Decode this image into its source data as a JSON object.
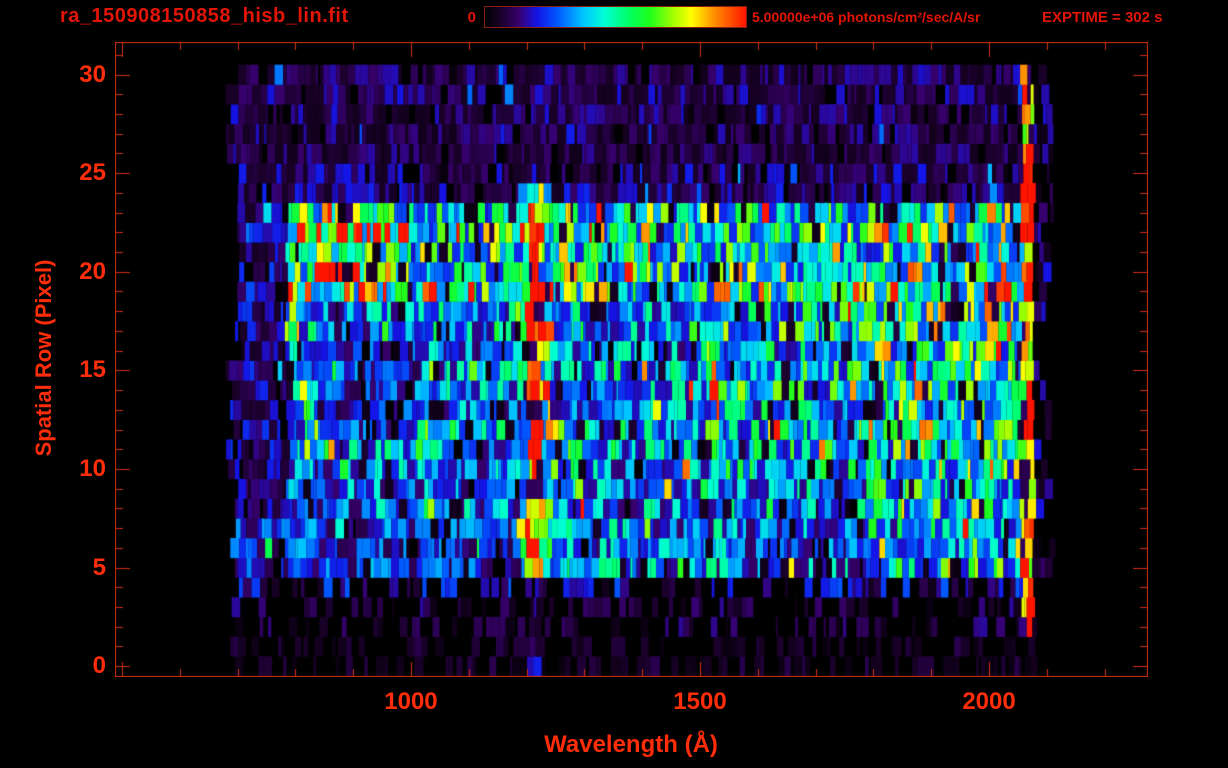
{
  "header": {
    "title": "ra_150908150858_hisb_lin.fit",
    "colorbar": {
      "min_label": "0",
      "max_label": "5.00000e+06 photons/cm²/sec/A/sr"
    },
    "exptime_label": "EXPTIME = 302 s"
  },
  "colors": {
    "accent": "#d2300e",
    "label_red": "#ff2d0a",
    "header_red": "#e21507",
    "background": "#000000"
  },
  "chart_data": {
    "type": "heatmap",
    "title": "ra_150908150858_hisb_lin.fit",
    "xlabel": "Wavelength (Å)",
    "ylabel": "Spatial Row (Pixel)",
    "x_axis": {
      "min": 488,
      "max": 2275,
      "labeled_ticks": [
        1000,
        1500,
        2000
      ],
      "minor_step": 100,
      "major_step": 500,
      "minor_from": 500,
      "minor_to": 2200
    },
    "y_axis": {
      "min": -0.55,
      "max": 31.65,
      "labeled_ticks": [
        0,
        5,
        10,
        15,
        20,
        25,
        30
      ],
      "minor_step": 1,
      "major_step": 5
    },
    "colorbar": {
      "min": 0,
      "max": 5000000,
      "units": "photons/cm²/sec/A/sr"
    },
    "exposure_seconds": 302,
    "grid": false,
    "colormap": {
      "stops": [
        [
          0.0,
          0,
          0,
          0
        ],
        [
          0.06,
          25,
          0,
          40
        ],
        [
          0.13,
          55,
          0,
          110
        ],
        [
          0.2,
          20,
          20,
          230
        ],
        [
          0.28,
          0,
          90,
          255
        ],
        [
          0.38,
          0,
          200,
          255
        ],
        [
          0.46,
          0,
          255,
          210
        ],
        [
          0.56,
          0,
          255,
          90
        ],
        [
          0.63,
          30,
          255,
          30
        ],
        [
          0.72,
          160,
          255,
          0
        ],
        [
          0.79,
          255,
          255,
          0
        ],
        [
          0.88,
          255,
          140,
          0
        ],
        [
          1.0,
          255,
          20,
          0
        ]
      ]
    },
    "data_extent": {
      "lambda": [
        678,
        2110
      ],
      "rows": [
        0,
        30
      ]
    },
    "bands": [
      {
        "name": "top-noise-rows-24-30",
        "rows": [
          24,
          30
        ],
        "segments": [
          {
            "l": [
              678,
              2058
            ],
            "v": 0.11
          },
          {
            "l": [
              2080,
              2110
            ],
            "v": 0.05
          }
        ]
      },
      {
        "name": "upper-bright-band-rows-19-23",
        "rows": [
          19,
          23
        ],
        "segments": [
          {
            "l": [
              678,
              785
            ],
            "v": 0.14
          },
          {
            "l": [
              785,
              1000
            ],
            "v": 0.6
          },
          {
            "l": [
              1000,
              1195
            ],
            "v": 0.46
          },
          {
            "l": [
              1195,
              1292
            ],
            "v": 0.55
          },
          {
            "l": [
              1292,
              1840
            ],
            "v": 0.47
          },
          {
            "l": [
              1840,
              2058
            ],
            "v": 0.56
          },
          {
            "l": [
              2080,
              2110
            ],
            "v": 0.05
          }
        ]
      },
      {
        "name": "yellow-blob-rows-20-22",
        "rows": [
          20,
          22
        ],
        "segments": [
          {
            "l": [
              840,
              995
            ],
            "v": 0.72
          }
        ]
      },
      {
        "name": "mid-band-rows-8-18",
        "rows": [
          8,
          18
        ],
        "segments": [
          {
            "l": [
              678,
              790
            ],
            "v": 0.13
          },
          {
            "l": [
              790,
              1195
            ],
            "v": 0.3
          },
          {
            "l": [
              1195,
              1232
            ],
            "v": 0.4
          },
          {
            "l": [
              1232,
              1500
            ],
            "v": 0.33
          },
          {
            "l": [
              1500,
              1840
            ],
            "v": 0.38
          },
          {
            "l": [
              1840,
              2058
            ],
            "v": 0.5
          },
          {
            "l": [
              2080,
              2110
            ],
            "v": 0.05
          }
        ]
      },
      {
        "name": "dark-patch-rows-12-17",
        "rows": [
          12,
          17
        ],
        "segments": [
          {
            "l": [
              835,
              1015
            ],
            "v": 0.21
          }
        ]
      },
      {
        "name": "lower-band-rows-5-7",
        "rows": [
          5,
          7
        ],
        "segments": [
          {
            "l": [
              690,
              1195
            ],
            "v": 0.24
          },
          {
            "l": [
              1195,
              1232
            ],
            "v": 0.4
          },
          {
            "l": [
              1232,
              1560
            ],
            "v": 0.33
          },
          {
            "l": [
              1560,
              1840
            ],
            "v": 0.3
          },
          {
            "l": [
              1840,
              2058
            ],
            "v": 0.45
          },
          {
            "l": [
              2080,
              2110
            ],
            "v": 0.04
          }
        ]
      },
      {
        "name": "row-4-noise",
        "rows": [
          4,
          4
        ],
        "segments": [
          {
            "l": [
              690,
              2080
            ],
            "v": 0.07
          }
        ]
      },
      {
        "name": "rows-2-3-sparse",
        "rows": [
          2,
          3
        ],
        "segments": [
          {
            "l": [
              690,
              2080
            ],
            "v": 0.04
          }
        ]
      },
      {
        "name": "rows-0-1-faint",
        "rows": [
          0,
          1
        ],
        "segments": [
          {
            "l": [
              690,
              2080
            ],
            "v": 0.025
          }
        ]
      }
    ],
    "lines": [
      {
        "name": "lyman-alpha-halo",
        "lambda": [
          1190,
          1245
        ],
        "rows": [
          5,
          24
        ],
        "v": 0.55
      },
      {
        "name": "lyman-alpha-core",
        "lambda": [
          1203,
          1227
        ],
        "rows": [
          5,
          23
        ],
        "v": 0.95
      },
      {
        "name": "lyman-alpha-faint-foot",
        "lambda": [
          1203,
          1227
        ],
        "rows": [
          0,
          4
        ],
        "v": 0.12
      },
      {
        "name": "green-column-right-of-lya",
        "lambda": [
          1232,
          1300
        ],
        "rows": [
          8,
          12
        ],
        "v": 0.45
      },
      {
        "name": "ovi-1030-column",
        "lambda": [
          1022,
          1036
        ],
        "rows": [
          5,
          17
        ],
        "v": 0.45
      },
      {
        "name": "green-band-1810",
        "lambda": [
          1795,
          1825
        ],
        "rows": [
          5,
          23
        ],
        "v": 0.52
      },
      {
        "name": "arc-hook-rows-10-11",
        "lambda": [
          860,
          950
        ],
        "rows": [
          10,
          11
        ],
        "v": 0.38
      },
      {
        "name": "bright-red-edge-2065",
        "lambda": [
          2058,
          2077
        ],
        "rows": [
          2,
          30
        ],
        "v": 0.9
      }
    ],
    "arc": {
      "name": "left-c-arc",
      "width": 26,
      "value": 0.5,
      "points": [
        {
          "row": 22,
          "lambda": 845
        },
        {
          "row": 21,
          "lambda": 832
        },
        {
          "row": 20,
          "lambda": 818
        },
        {
          "row": 19,
          "lambda": 806
        },
        {
          "row": 18,
          "lambda": 799
        },
        {
          "row": 17,
          "lambda": 795
        },
        {
          "row": 16,
          "lambda": 795
        },
        {
          "row": 15,
          "lambda": 799
        },
        {
          "row": 14,
          "lambda": 806
        },
        {
          "row": 13,
          "lambda": 818
        },
        {
          "row": 12,
          "lambda": 834
        },
        {
          "row": 11,
          "lambda": 856
        },
        {
          "row": 10,
          "lambda": 882
        }
      ]
    },
    "noise": {
      "seed": 1509,
      "gap_chance": 0.1,
      "gap_factor": 0.12,
      "bright_chance": 0.06,
      "bright_factor": 1.7,
      "sparse_threshold": 0.08,
      "sparse_blank_chance": 0.55
    }
  }
}
